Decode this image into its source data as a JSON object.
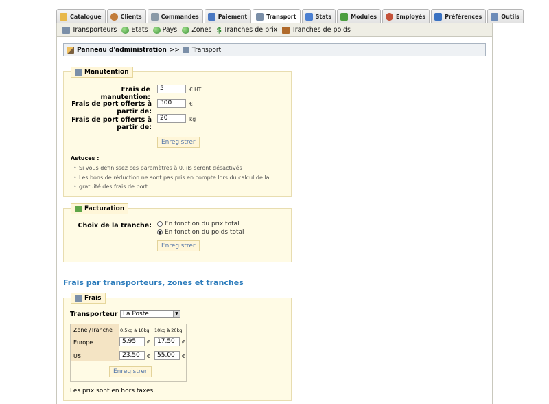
{
  "tabs": [
    {
      "label": "Catalogue",
      "icon": "folder-icon",
      "color": "#e8b84a"
    },
    {
      "label": "Clients",
      "icon": "user-icon",
      "color": "#c27c3a"
    },
    {
      "label": "Commandes",
      "icon": "list-icon",
      "color": "#8a9aa8"
    },
    {
      "label": "Paiement",
      "icon": "payment-icon",
      "color": "#4a78c2"
    },
    {
      "label": "Transport",
      "icon": "truck-icon",
      "color": "#7b8fa8",
      "active": true
    },
    {
      "label": "Stats",
      "icon": "chart-icon",
      "color": "#4b7fd1"
    },
    {
      "label": "Modules",
      "icon": "puzzle-icon",
      "color": "#4c9e3f"
    },
    {
      "label": "Employés",
      "icon": "employee-icon",
      "color": "#c4523a"
    },
    {
      "label": "Préférences",
      "icon": "preferences-icon",
      "color": "#3a72c2"
    },
    {
      "label": "Outils",
      "icon": "tools-icon",
      "color": "#6c8bb8"
    }
  ],
  "subtabs": [
    {
      "label": "Transporteurs",
      "icon": "truck-icon"
    },
    {
      "label": "Etats",
      "icon": "globe-icon"
    },
    {
      "label": "Pays",
      "icon": "globe-icon"
    },
    {
      "label": "Zones",
      "icon": "globe-icon"
    },
    {
      "label": "Tranches de prix",
      "icon": "dollar-icon"
    },
    {
      "label": "Tranches de poids",
      "icon": "weight-box-icon"
    }
  ],
  "breadcrumb": {
    "root": "Panneau d'administration",
    "sep": ">>",
    "current": "Transport"
  },
  "handling": {
    "legend": "Manutention",
    "fee_label": "Frais de manutention:",
    "fee_value": "5",
    "fee_unit": "€ HT",
    "free_price_label_1": "Frais de port offerts à",
    "free_price_label_2": "partir de:",
    "free_price_value": "300",
    "free_price_unit": "€",
    "free_weight_label_1": "Frais de port offerts à",
    "free_weight_label_2": "partir de:",
    "free_weight_value": "20",
    "free_weight_unit": "kg",
    "save": "Enregistrer",
    "tips_title": "Astuces :",
    "tip1": "Si vous définissez ces paramètres à 0, ils seront désactivés",
    "tip2a": "Les bons de réduction ne sont pas pris en compte lors du calcul de la",
    "tip2b": "gratuité des frais de port"
  },
  "billing": {
    "legend": "Facturation",
    "label": "Choix de la tranche:",
    "opt1": "En fonction du prix total",
    "opt2": "En fonction du poids total",
    "save": "Enregistrer"
  },
  "fees": {
    "section_title": "Frais par transporteurs, zones et tranches",
    "legend": "Frais",
    "carrier_label": "Transporteur :",
    "carrier_value": "La Poste",
    "col_zone": "Zone /Tranche",
    "col1": "0.5kg à 10kg",
    "col2": "10kg à 20kg",
    "rows": [
      {
        "zone": "Europe",
        "v1": "5.95",
        "v2": "17.50"
      },
      {
        "zone": "US",
        "v1": "23.50",
        "v2": "55.00"
      }
    ],
    "currency": "€",
    "save": "Enregistrer",
    "note": "Les prix sont en hors taxes."
  }
}
